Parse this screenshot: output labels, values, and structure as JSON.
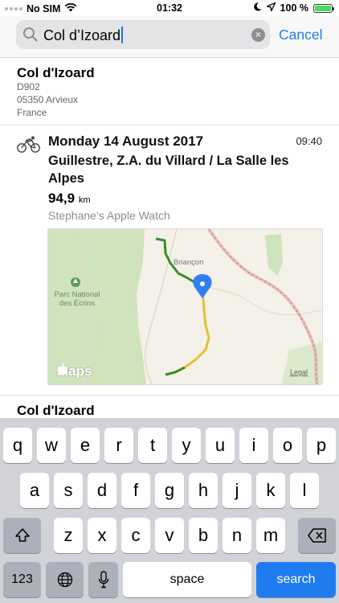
{
  "status_bar": {
    "carrier": "No SIM",
    "time": "01:32",
    "battery": "100 %",
    "battery_level": 1.0,
    "icons": [
      "signal-dots-icon",
      "wifi-icon",
      "moon-icon",
      "location-arrow-icon",
      "battery-icon"
    ]
  },
  "search": {
    "query": "Col d’Izoard",
    "cancel_label": "Cancel",
    "icons": [
      "magnifier-icon",
      "clear-icon"
    ]
  },
  "results": {
    "place": {
      "title": "Col d'Izoard",
      "address": [
        "D902",
        "05350 Arvieux",
        "France"
      ]
    },
    "workout": {
      "date": "Monday 14 August 2017",
      "time": "09:40",
      "title": "Guillestre, Z.A. du Villard / La Salle les Alpes",
      "distance": "94,9",
      "distance_unit": "km",
      "source": "Stephane’s Apple Watch",
      "icon": "cycling-icon",
      "map": {
        "labels": {
          "town": "Briançon",
          "park": "Parc National des Écrins"
        },
        "logo": "Maps",
        "legal": "Legal",
        "pin_color": "#2f7ff0",
        "route_colors": [
          "#3d8c2e",
          "#e2c234"
        ]
      }
    },
    "more": {
      "title": "Col d'Izoard"
    }
  },
  "keyboard": {
    "row1": [
      "q",
      "w",
      "e",
      "r",
      "t",
      "y",
      "u",
      "i",
      "o",
      "p"
    ],
    "row2": [
      "a",
      "s",
      "d",
      "f",
      "g",
      "h",
      "j",
      "k",
      "l"
    ],
    "row3": [
      "z",
      "x",
      "c",
      "v",
      "b",
      "n",
      "m"
    ],
    "numbers_label": "123",
    "space_label": "space",
    "search_label": "search",
    "accent_color": "#1f7cf0"
  }
}
